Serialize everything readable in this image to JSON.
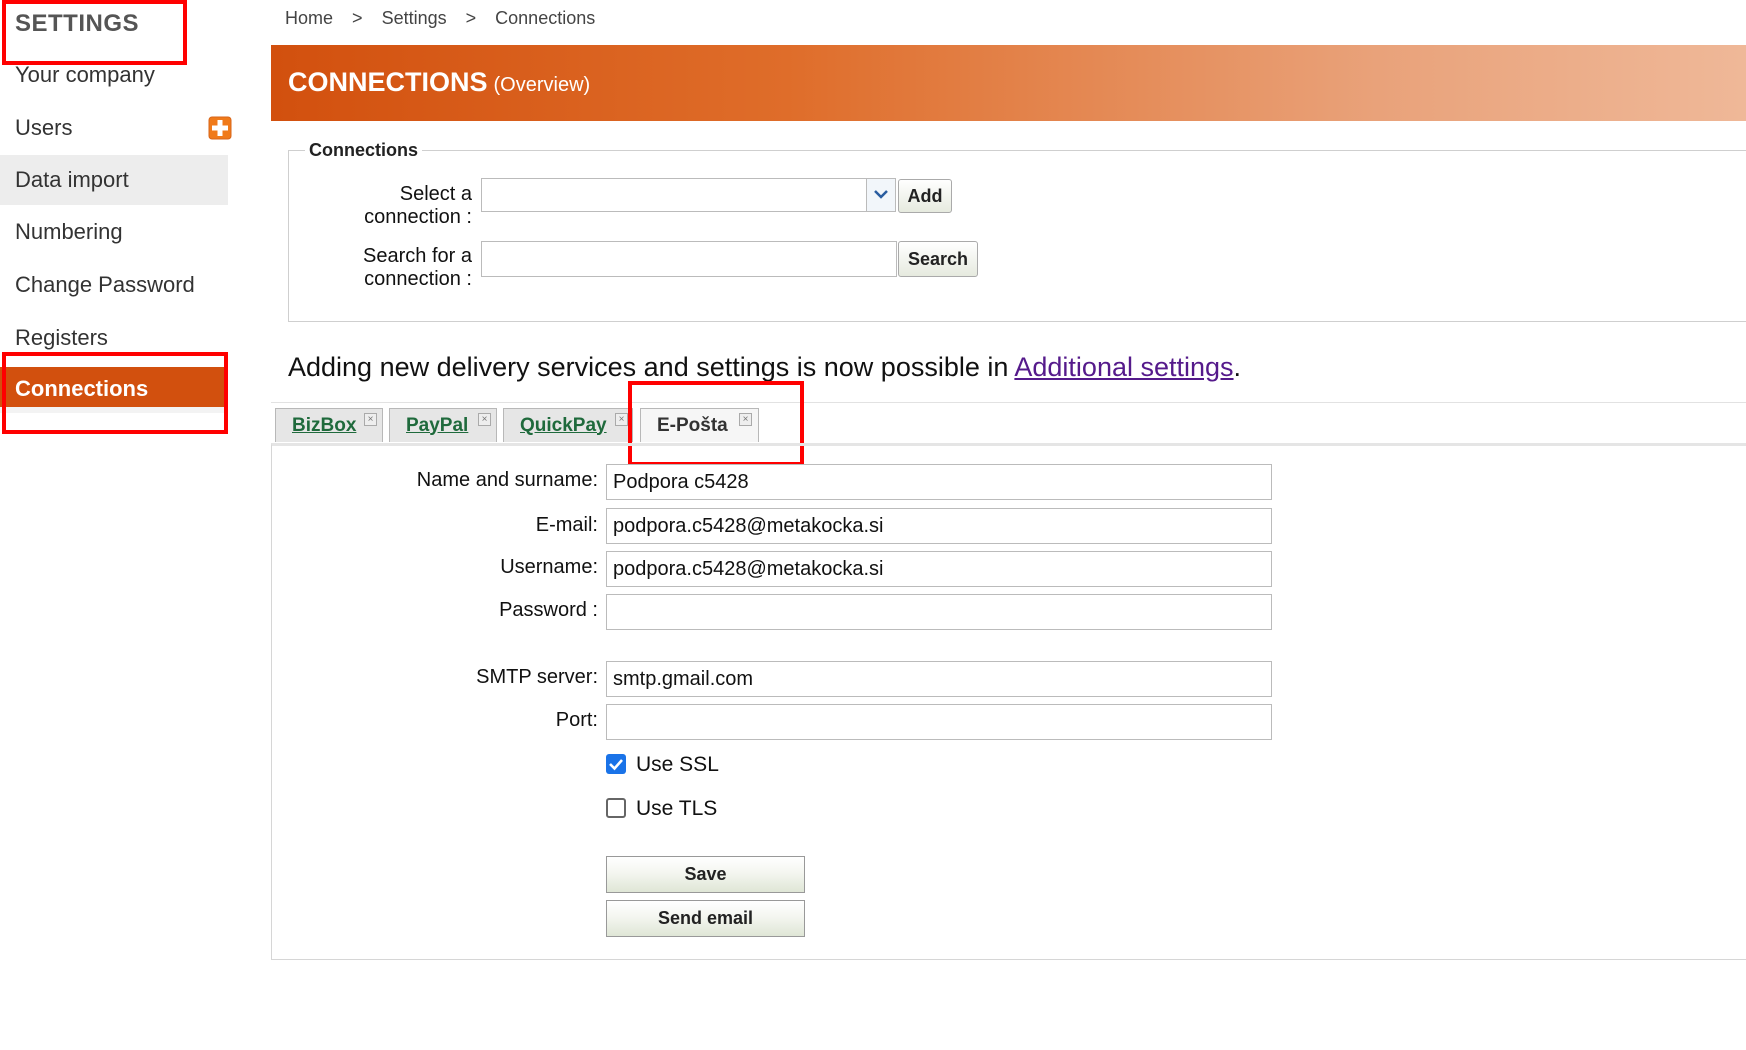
{
  "sidebar": {
    "title": "SETTINGS",
    "items": [
      {
        "label": "Your company"
      },
      {
        "label": "Users"
      },
      {
        "label": "Data import"
      },
      {
        "label": "Numbering"
      },
      {
        "label": "Change Password"
      },
      {
        "label": "Registers"
      },
      {
        "label": "Connections"
      }
    ]
  },
  "breadcrumb": [
    ">",
    "Home",
    "Settings",
    "Connections"
  ],
  "breadcrumb_items": {
    "home": "Home",
    "sep": ">",
    "settings": "Settings",
    "connections": "Connections"
  },
  "header": {
    "title": "CONNECTIONS",
    "subtitle": "(Overview)"
  },
  "connections": {
    "legend": "Connections",
    "select_label": "Select a connection :",
    "select_value": "",
    "add_label": "Add",
    "search_label": "Search for a connection :",
    "search_value": "",
    "search_button": "Search"
  },
  "notice": {
    "text": "Adding new delivery services and settings is now possible in ",
    "link": "Additional settings",
    "end": "."
  },
  "tabs": [
    {
      "label": "BizBox",
      "active": false
    },
    {
      "label": "PayPal",
      "active": false
    },
    {
      "label": "QuickPay",
      "active": false
    },
    {
      "label": "E-Pošta",
      "active": true
    }
  ],
  "form": {
    "name_label": "Name and surname:",
    "name_value": "Podpora c5428",
    "email_label": "E-mail:",
    "email_value": "podpora.c5428@metakocka.si",
    "username_label": "Username:",
    "username_value": "podpora.c5428@metakocka.si",
    "password_label": "Password :",
    "password_value": "",
    "smtp_label": "SMTP server:",
    "smtp_value": "smtp.gmail.com",
    "port_label": "Port:",
    "port_value": "",
    "use_ssl_label": "Use SSL",
    "use_ssl": true,
    "use_tls_label": "Use TLS",
    "use_tls": false,
    "save_label": "Save",
    "send_email_label": "Send email"
  },
  "colors": {
    "accent": "#d2500e",
    "highlight_box": "#ff0000",
    "tab_link": "#1f6a3c",
    "link": "#551a8b"
  },
  "icons": {
    "users_add": "plus-square-icon",
    "select_arrow": "chevron-down-icon",
    "tab_close": "close-icon"
  }
}
